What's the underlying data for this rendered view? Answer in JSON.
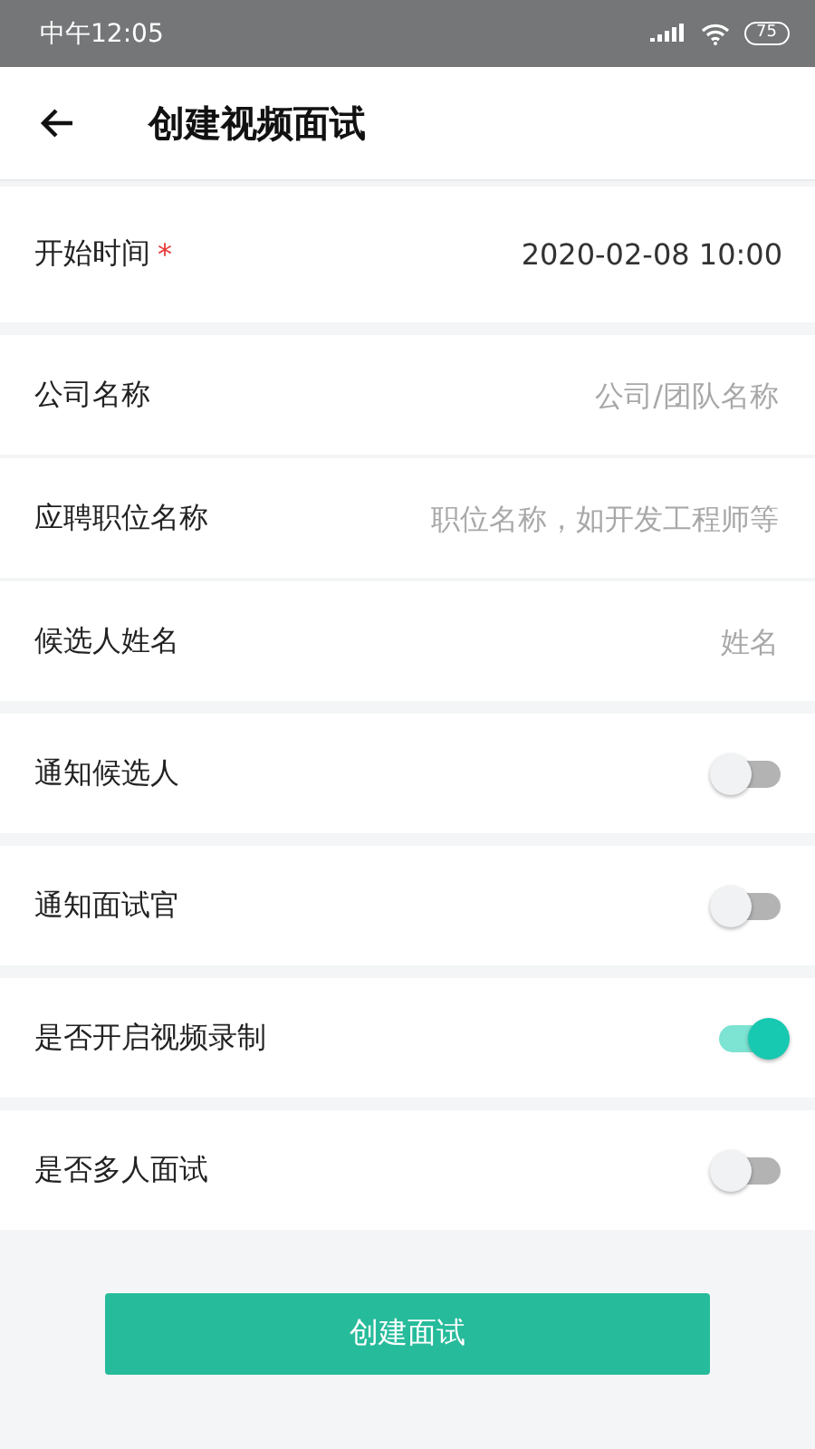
{
  "status_bar": {
    "time": "中午12:05",
    "battery": "75"
  },
  "header": {
    "title": "创建视频面试"
  },
  "groups": [
    {
      "rows": [
        {
          "kind": "value",
          "label": "开始时间",
          "required": true,
          "required_mark": "*",
          "value": "2020-02-08 10:00"
        }
      ]
    },
    {
      "rows": [
        {
          "kind": "input",
          "label": "公司名称",
          "placeholder": "公司/团队名称"
        },
        {
          "kind": "input",
          "label": "应聘职位名称",
          "placeholder": "职位名称，如开发工程师等"
        },
        {
          "kind": "input",
          "label": "候选人姓名",
          "placeholder": "姓名"
        }
      ]
    },
    {
      "rows": [
        {
          "kind": "toggle",
          "label": "通知候选人",
          "on": false
        }
      ]
    },
    {
      "rows": [
        {
          "kind": "toggle",
          "label": "通知面试官",
          "on": false
        }
      ]
    },
    {
      "rows": [
        {
          "kind": "toggle",
          "label": "是否开启视频录制",
          "on": true
        }
      ]
    },
    {
      "rows": [
        {
          "kind": "toggle",
          "label": "是否多人面试",
          "on": false
        }
      ]
    }
  ],
  "submit": {
    "label": "创建面试"
  }
}
